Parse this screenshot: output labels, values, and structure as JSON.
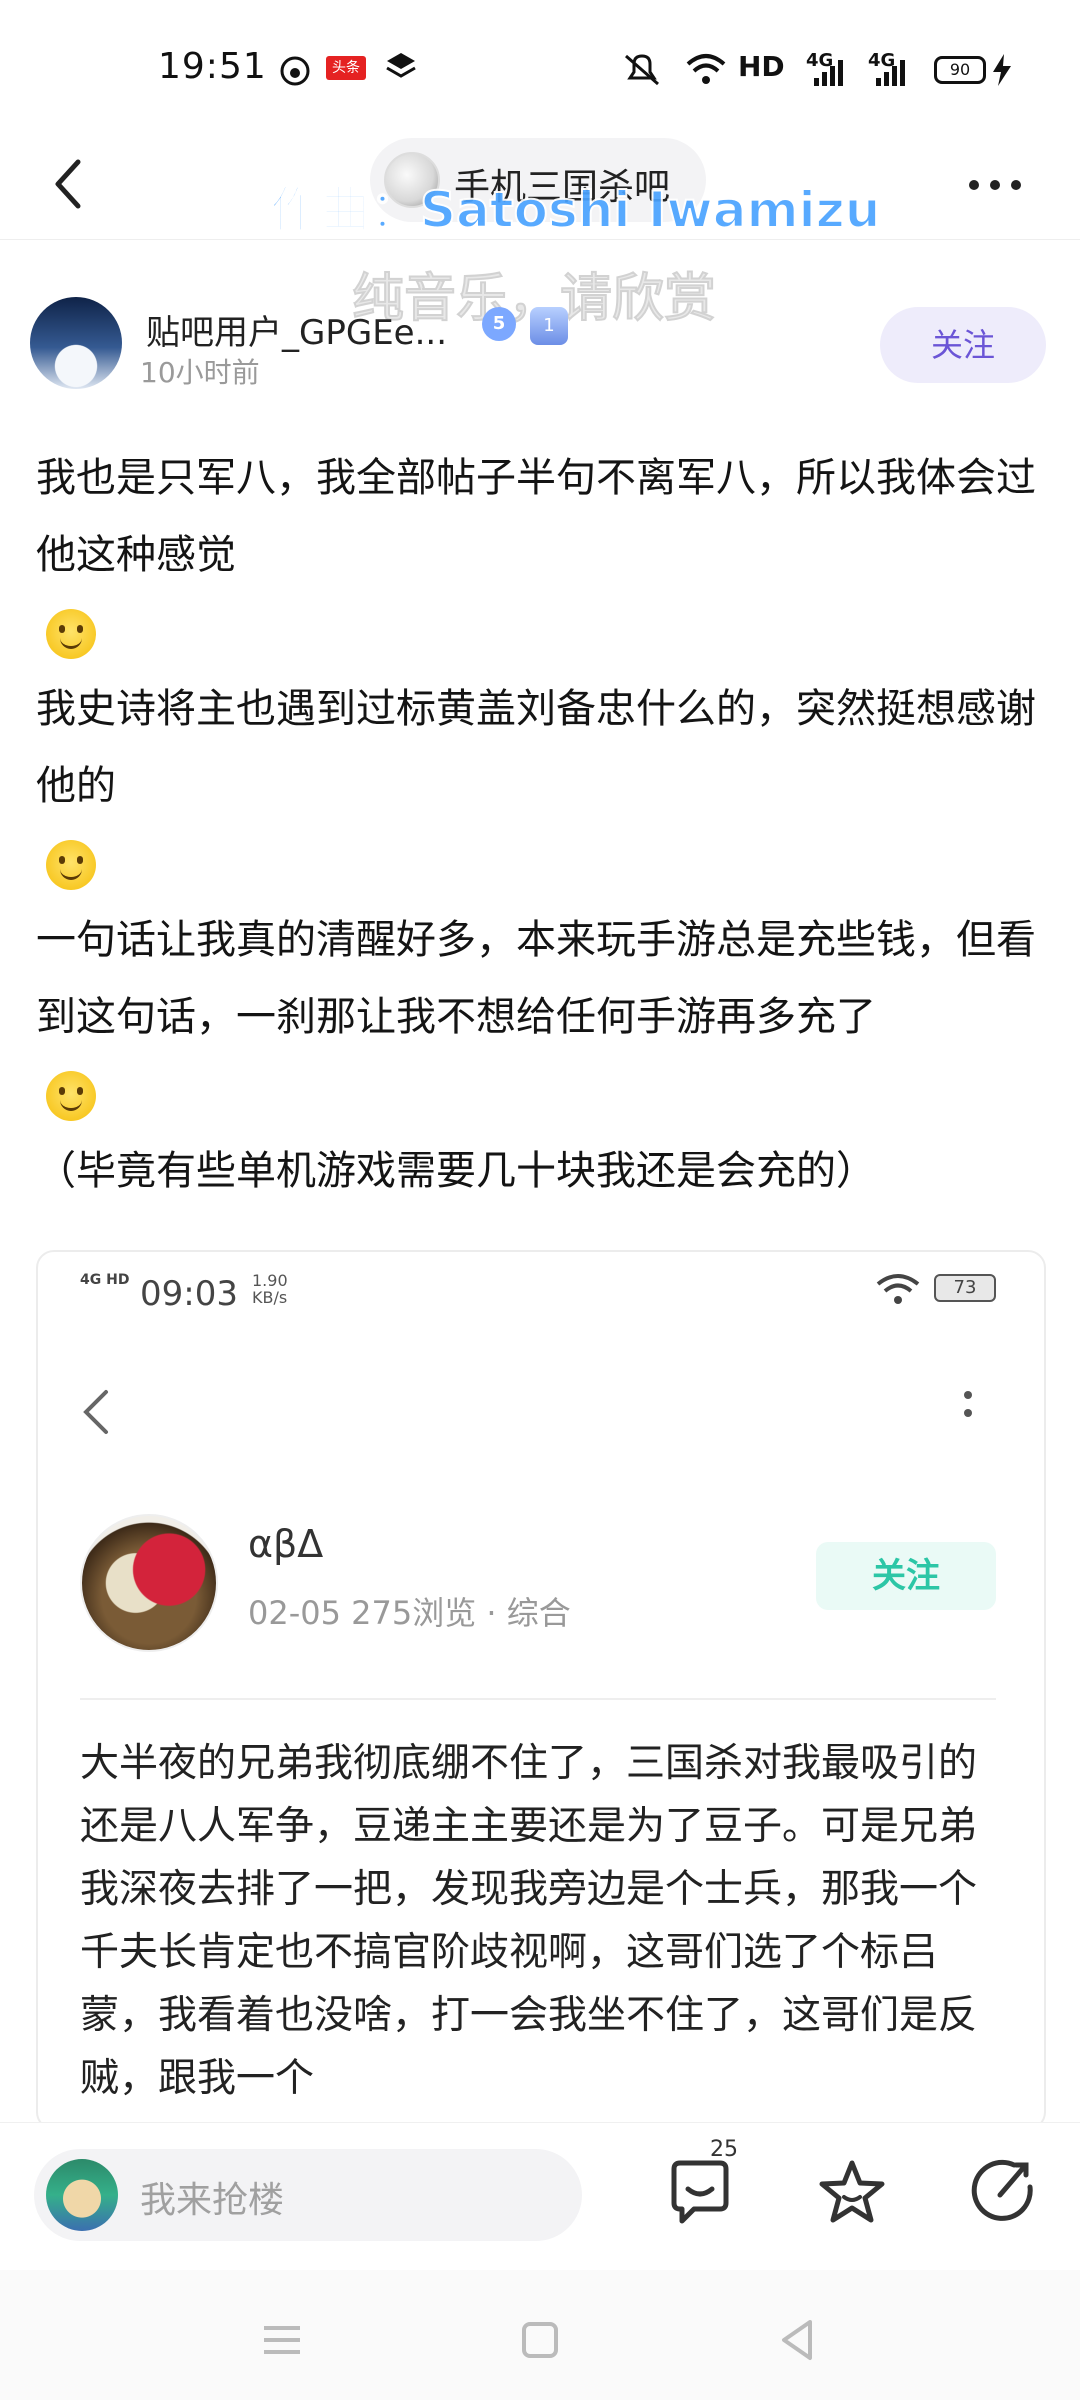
{
  "status_bar": {
    "time": "19:51",
    "news_badge": "头条",
    "network_label": "HD",
    "signal_1": "4G",
    "signal_2": "4G",
    "battery": "90"
  },
  "nav": {
    "forum_name": "手机三国杀吧",
    "back_icon": "chevron-left-icon",
    "more_icon": "more-horizontal-icon"
  },
  "video_overlay": {
    "composer": "作曲：Satoshi Iwamizu",
    "music_note": "纯音乐，请欣赏"
  },
  "author": {
    "name": "贴吧用户_GPGEe...",
    "level": "5",
    "member_level": "1",
    "post_time": "10小时前",
    "follow_label": "关注"
  },
  "post": {
    "paragraphs": [
      "我也是只军八，我全部帖子半句不离军八，所以我体会过他这种感觉",
      "我史诗将主也遇到过标黄盖刘备忠什么的，突然挺想感谢他的",
      "一句话让我真的清醒好多，本来玩手游总是充些钱，但看到这句话，一刹那让我不想给任何手游再多充了",
      "（毕竟有些单机游戏需要几十块我还是会充的）"
    ]
  },
  "embedded_screenshot": {
    "network": "4G HD",
    "time": "09:03",
    "speed_value": "1.90",
    "speed_unit": "KB/s",
    "battery": "73",
    "author_name": "αβΔ",
    "meta": "02-05 275浏览 · 综合",
    "follow_label": "关注",
    "body": "大半夜的兄弟我彻底绷不住了，三国杀对我最吸引的还是八人军争，豆递主主要还是为了豆子。可是兄弟我深夜去排了一把，发现我旁边是个士兵，那我一个千夫长肯定也不搞官阶歧视啊，这哥们选了个标吕蒙，我看着也没啥，打一会我坐不住了，这哥们是反贼，跟我一个"
  },
  "bottom_bar": {
    "reply_placeholder": "我来抢楼",
    "comment_count": "25",
    "comment_icon": "comment-icon",
    "favorite_icon": "star-icon",
    "share_icon": "share-icon"
  },
  "colors": {
    "accent_purple": "#6b55d6",
    "follow_bg": "#eeecfb",
    "embedded_follow": "#2cc6a6"
  }
}
